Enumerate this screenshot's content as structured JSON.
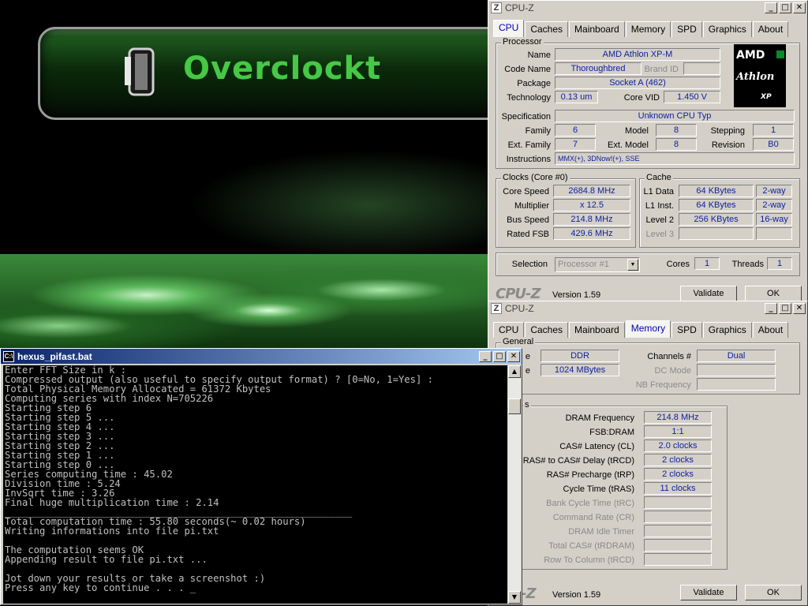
{
  "desktop": {
    "banner_text": "Overclockt"
  },
  "cpuz_main": {
    "title": "CPU-Z",
    "tabs": [
      "CPU",
      "Caches",
      "Mainboard",
      "Memory",
      "SPD",
      "Graphics",
      "About"
    ],
    "active_tab": "CPU",
    "processor": {
      "group": "Processor",
      "name_label": "Name",
      "name": "AMD Athlon XP-M",
      "codename_label": "Code Name",
      "codename": "Thoroughbred",
      "brandid_label": "Brand ID",
      "brandid": "",
      "package_label": "Package",
      "package": "Socket A (462)",
      "technology_label": "Technology",
      "technology": "0.13 um",
      "corevid_label": "Core VID",
      "corevid": "1.450 V",
      "spec_label": "Specification",
      "spec": "Unknown CPU Typ",
      "family_label": "Family",
      "family": "6",
      "model_label": "Model",
      "model": "8",
      "stepping_label": "Stepping",
      "stepping": "1",
      "extfamily_label": "Ext. Family",
      "extfamily": "7",
      "extmodel_label": "Ext. Model",
      "extmodel": "8",
      "revision_label": "Revision",
      "revision": "B0",
      "instructions_label": "Instructions",
      "instructions": "MMX(+), 3DNow!(+), SSE",
      "logo": {
        "brand": "AMD",
        "line": "Athlon",
        "suffix": "XP"
      }
    },
    "clocks": {
      "group": "Clocks (Core #0)",
      "corespeed_label": "Core Speed",
      "corespeed": "2684.8 MHz",
      "multiplier_label": "Multiplier",
      "multiplier": "x 12.5",
      "busspeed_label": "Bus Speed",
      "busspeed": "214.8 MHz",
      "ratedfsb_label": "Rated FSB",
      "ratedfsb": "429.6 MHz"
    },
    "cache": {
      "group": "Cache",
      "l1d_label": "L1 Data",
      "l1d": "64 KBytes",
      "l1d_way": "2-way",
      "l1i_label": "L1 Inst.",
      "l1i": "64 KBytes",
      "l1i_way": "2-way",
      "l2_label": "Level 2",
      "l2": "256 KBytes",
      "l2_way": "16-way",
      "l3_label": "Level 3"
    },
    "selection_label": "Selection",
    "selection": "Processor #1",
    "cores_label": "Cores",
    "cores": "1",
    "threads_label": "Threads",
    "threads": "1",
    "brand": "CPU-Z",
    "version": "Version 1.59",
    "validate": "Validate",
    "ok": "OK"
  },
  "cpuz_mem": {
    "title": "CPU-Z",
    "tabs": [
      "CPU",
      "Caches",
      "Mainboard",
      "Memory",
      "SPD",
      "Graphics",
      "About"
    ],
    "active_tab": "Memory",
    "general": {
      "group": "General",
      "type_label": "e",
      "type": "DDR",
      "size_label": "e",
      "size": "1024 MBytes",
      "channels_label": "Channels #",
      "channels": "Dual",
      "dcmode_label": "DC Mode",
      "dcmode": "",
      "nbfreq_label": "NB Frequency",
      "nbfreq": ""
    },
    "timings": {
      "group": "s",
      "dram_freq_label": "DRAM Frequency",
      "dram_freq": "214.8 MHz",
      "fsb_dram_label": "FSB:DRAM",
      "fsb_dram": "1:1",
      "cas_label": "CAS# Latency (CL)",
      "cas": "2.0 clocks",
      "rcd_label": "RAS# to CAS# Delay (tRCD)",
      "rcd": "2 clocks",
      "rp_label": "RAS# Precharge (tRP)",
      "rp": "2 clocks",
      "ras_label": "Cycle Time (tRAS)",
      "ras": "11 clocks",
      "trc_label": "Bank Cycle Time (tRC)",
      "cr_label": "Command Rate (CR)",
      "idle_label": "DRAM Idle Timer",
      "trdram_label": "Total CAS# (tRDRAM)",
      "trcd2_label": "Row To Column (tRCD)"
    },
    "version": "Version 1.59",
    "validate": "Validate",
    "ok": "OK"
  },
  "console": {
    "title": "hexus_pifast.bat",
    "lines": [
      "Enter FFT Size in k :",
      "Compressed output (also useful to specify output format) ? [0=No, 1=Yes] :",
      "Total Physical Memory Allocated = 61372 Kbytes",
      "Computing series with index N=705226",
      "Starting step 6",
      "Starting step 5 ...",
      "Starting step 4 ...",
      "Starting step 3 ...",
      "Starting step 2 ...",
      "Starting step 1 ...",
      "Starting step 0 ...",
      "Series computing time : 45.02",
      "Division time : 5.24",
      "InvSqrt time : 3.26",
      "Final huge multiplication time : 2.14",
      "____________________________________________________________",
      "Total computation time : 55.80 seconds(~ 0.02 hours)",
      "Writing informations into file pi.txt",
      "",
      "The computation seems OK",
      "Appending result to file pi.txt ...",
      "",
      "Jot down your results or take a screenshot :)",
      "Press any key to continue . . . _"
    ]
  }
}
